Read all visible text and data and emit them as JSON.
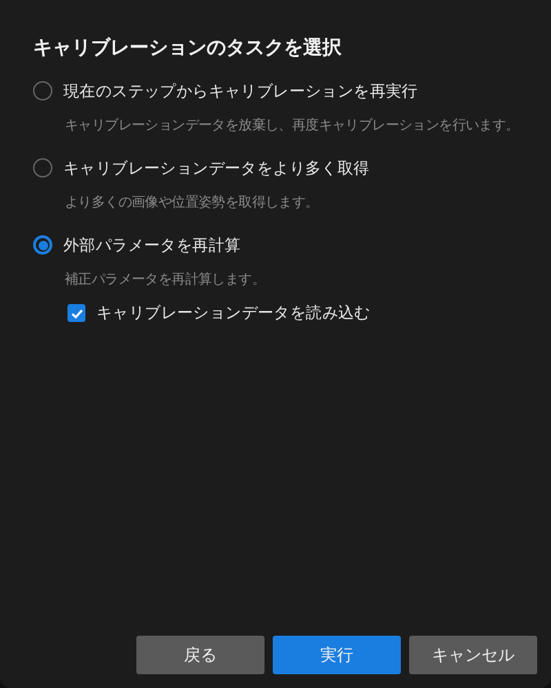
{
  "dialog": {
    "title": "キャリブレーションのタスクを選択",
    "options": [
      {
        "label": "現在のステップからキャリブレーションを再実行",
        "description": "キャリブレーションデータを放棄し、再度キャリブレーションを行います。",
        "selected": false
      },
      {
        "label": "キャリブレーションデータをより多く取得",
        "description": "より多くの画像や位置姿勢を取得します。",
        "selected": false
      },
      {
        "label": "外部パラメータを再計算",
        "description": "補正パラメータを再計算します。",
        "selected": true,
        "sub_checkbox": {
          "label": "キャリブレーションデータを読み込む",
          "checked": true
        }
      }
    ],
    "buttons": [
      {
        "label": "戻る",
        "kind": "secondary"
      },
      {
        "label": "実行",
        "kind": "primary"
      },
      {
        "label": "キャンセル",
        "kind": "secondary"
      }
    ]
  }
}
